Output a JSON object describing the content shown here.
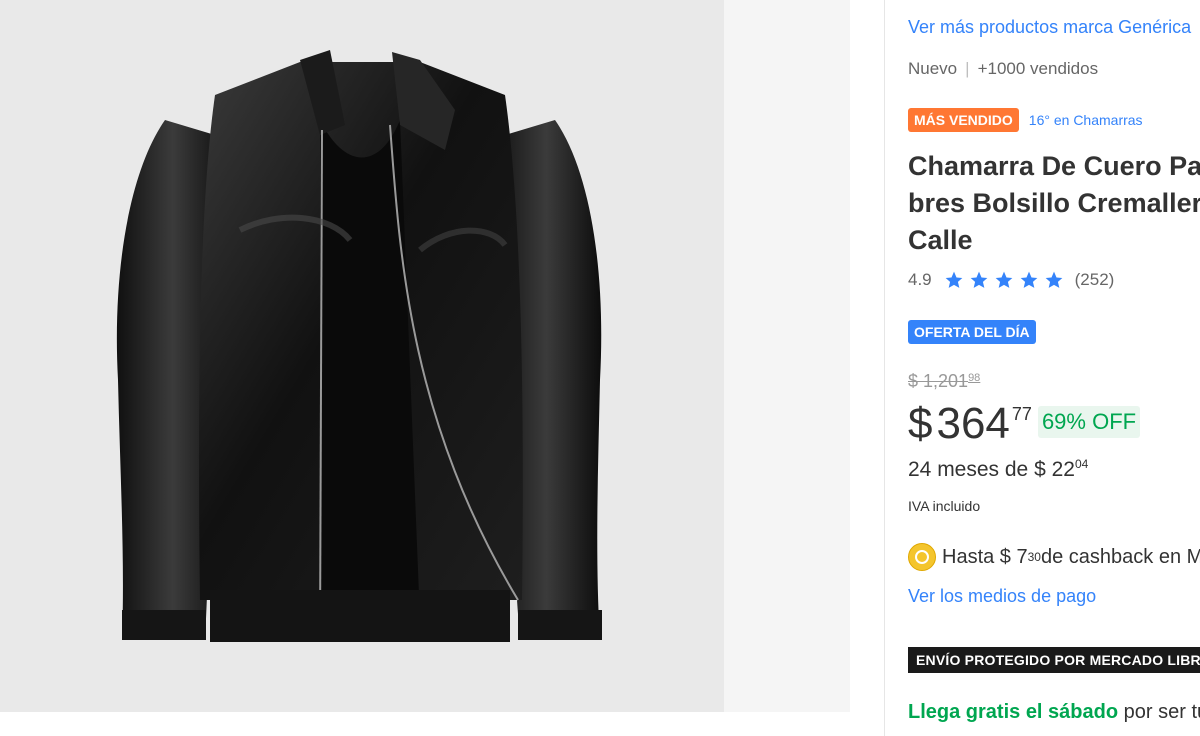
{
  "gallery": {
    "image_name": "black-leather-jacket"
  },
  "product": {
    "brand_link": "Ver más productos marca Genérica",
    "condition": "Nuevo",
    "sold": "+1000 vendidos",
    "best_seller_badge": "MÁS VENDIDO",
    "rank_link": "16° en Chamarras",
    "title_lines": [
      "Chamarra De Cuero Para Hom",
      "bres Bolsillo Cremallera",
      "Calle"
    ],
    "rating": "4.9",
    "stars": 5,
    "reviews": "(252)",
    "deal_badge": "OFERTA DEL DÍA",
    "old_price_int": "$ 1,201",
    "old_price_cents": "98",
    "currency": "$",
    "price_int": "364",
    "price_cents": "77",
    "discount": "69% OFF",
    "installments_text": "24 meses de $ 22",
    "installments_cents": "04",
    "tax_note": "IVA incluido",
    "cashback_prefix": "Hasta $ 7",
    "cashback_cents": "30",
    "cashback_suffix": " de cashback en Mercado Pago",
    "payment_link": "Ver los medios de pago",
    "protected_banner": "ENVÍO PROTEGIDO POR MERCADO LIBRE",
    "delivery_highlight": "Llega gratis el sábado",
    "delivery_rest": " por ser tu primera compra"
  },
  "colors": {
    "link": "#3483fa",
    "best_seller": "#ff7733",
    "discount": "#00a650",
    "star": "#3483fa"
  }
}
